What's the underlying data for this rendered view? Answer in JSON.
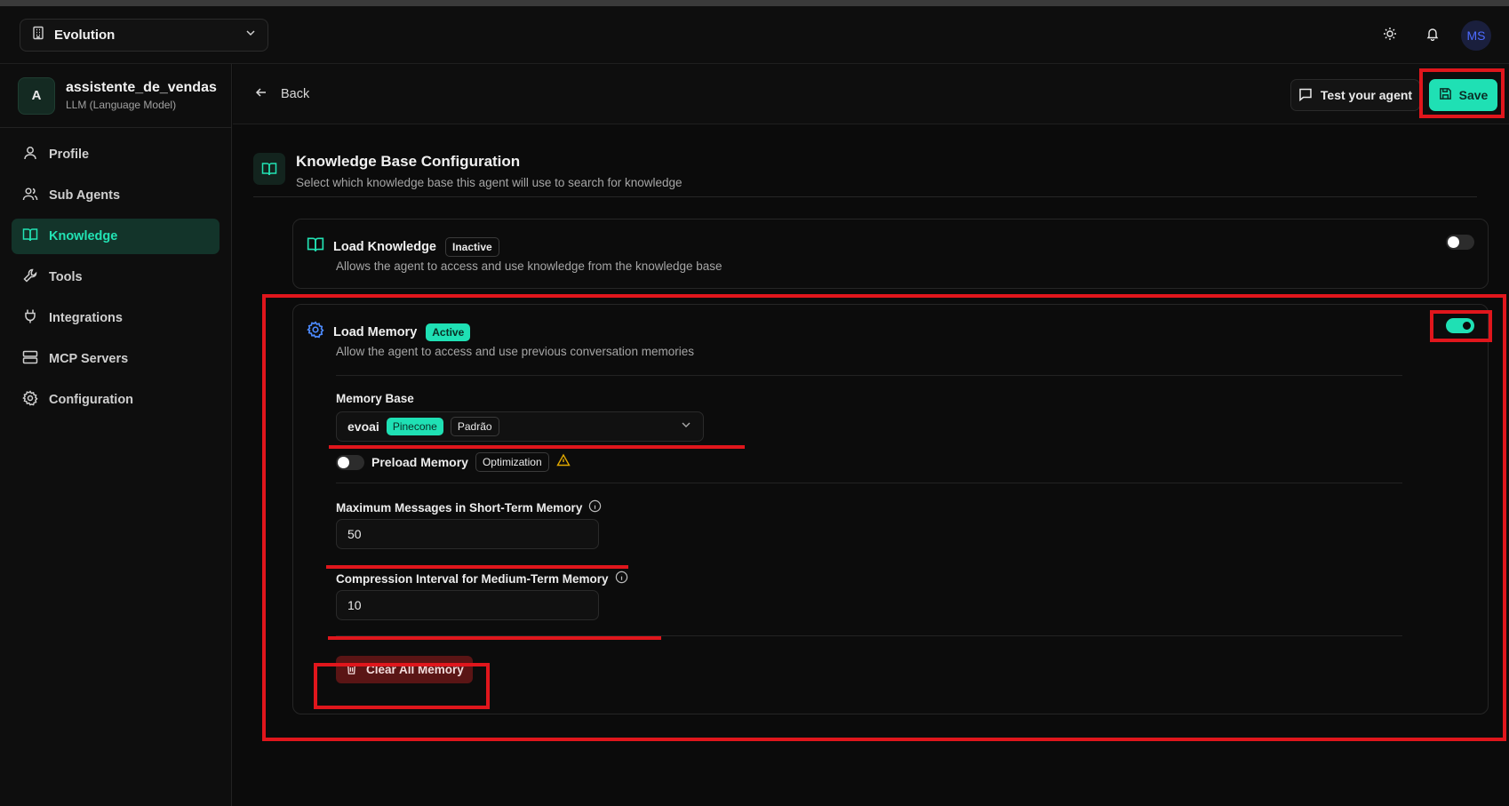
{
  "topbar": {
    "org_name": "Evolution",
    "avatar_initials": "MS",
    "icons": [
      "building-icon",
      "chevron-down-icon",
      "sun-icon",
      "bell-icon"
    ]
  },
  "sidebar": {
    "agent": {
      "initial": "A",
      "name": "assistente_de_vendas",
      "type": "LLM (Language Model)"
    },
    "items": [
      {
        "label": "Profile",
        "icon": "user-icon",
        "active": false
      },
      {
        "label": "Sub Agents",
        "icon": "users-icon",
        "active": false
      },
      {
        "label": "Knowledge",
        "icon": "book-icon",
        "active": true
      },
      {
        "label": "Tools",
        "icon": "wrench-icon",
        "active": false
      },
      {
        "label": "Integrations",
        "icon": "plug-icon",
        "active": false
      },
      {
        "label": "MCP Servers",
        "icon": "server-icon",
        "active": false
      },
      {
        "label": "Configuration",
        "icon": "gear-icon",
        "active": false
      }
    ]
  },
  "header": {
    "back_label": "Back",
    "test_label": "Test your agent",
    "save_label": "Save"
  },
  "section": {
    "title": "Knowledge Base Configuration",
    "subtitle": "Select which knowledge base this agent will use to search for knowledge"
  },
  "knowledge_card": {
    "title": "Load Knowledge",
    "status": "Inactive",
    "description": "Allows the agent to access and use knowledge from the knowledge base",
    "enabled": false
  },
  "memory_card": {
    "title": "Load Memory",
    "status": "Active",
    "description": "Allow the agent to access and use previous conversation memories",
    "enabled": true,
    "memory_base_label": "Memory Base",
    "memory_base_value": "evoai",
    "memory_base_tags": [
      "Pinecone",
      "Padrão"
    ],
    "preload_label": "Preload Memory",
    "preload_badge": "Optimization",
    "preload_enabled": false,
    "max_messages_label": "Maximum Messages in Short-Term Memory",
    "max_messages_value": "50",
    "compression_label": "Compression Interval for Medium-Term Memory",
    "compression_value": "10",
    "clear_label": "Clear All Memory"
  },
  "colors": {
    "accent": "#1fe0b4",
    "highlight": "#e0161c",
    "danger_bg": "#5a1515",
    "warning": "#e0a800"
  }
}
